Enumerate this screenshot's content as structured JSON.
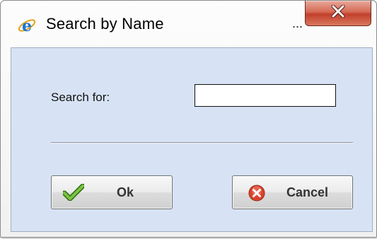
{
  "window": {
    "title": "Search by Name",
    "title_overflow": "...",
    "icon": "internet-explorer-icon",
    "close_icon": "close-icon",
    "close_button_color": "#c2402b"
  },
  "form": {
    "search_label": "Search for:",
    "search_value": "",
    "background_color": "#d7e3f5"
  },
  "buttons": {
    "ok_label": "Ok",
    "ok_icon": "checkmark-icon",
    "cancel_label": "Cancel",
    "cancel_icon": "cancel-x-icon"
  }
}
